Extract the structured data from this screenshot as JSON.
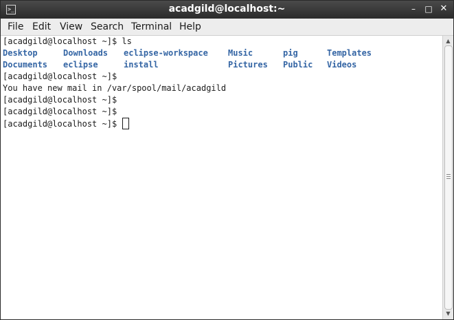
{
  "window": {
    "title": "acadgild@localhost:~",
    "icon": "terminal-icon",
    "icon_glyph": ">_",
    "minimize_glyph": "–",
    "maximize_glyph": "□",
    "close_glyph": "✕"
  },
  "menu": {
    "file": "File",
    "edit": "Edit",
    "view": "View",
    "search": "Search",
    "terminal": "Terminal",
    "help": "Help"
  },
  "terminal": {
    "line1": "[acadgild@localhost ~]$ ls",
    "ls_row1": [
      "Desktop",
      "Downloads",
      "eclipse-workspace",
      "Music",
      "pig",
      "Templates"
    ],
    "ls_row2": [
      "Documents",
      "eclipse",
      "install",
      "Pictures",
      "Public",
      "Videos"
    ],
    "line4": "[acadgild@localhost ~]$",
    "line5": "You have new mail in /var/spool/mail/acadgild",
    "line6": "[acadgild@localhost ~]$",
    "line7": "[acadgild@localhost ~]$",
    "prompt": "[acadgild@localhost ~]$ "
  },
  "colors": {
    "directory": "#3465a4",
    "text": "#1a1a1a",
    "titlebar": "#2b2b2b"
  }
}
